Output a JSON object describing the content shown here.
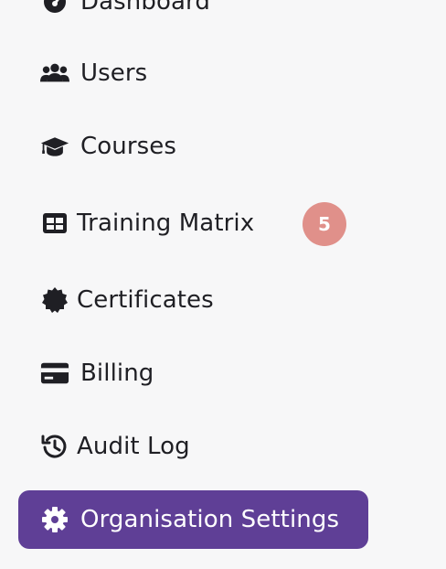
{
  "sidebar": {
    "items": [
      {
        "label": "Dashboard",
        "icon": "dashboard-icon"
      },
      {
        "label": "Users",
        "icon": "users-icon"
      },
      {
        "label": "Courses",
        "icon": "graduation-cap-icon"
      },
      {
        "label": "Training Matrix",
        "icon": "table-icon",
        "badge": "5"
      },
      {
        "label": "Certificates",
        "icon": "certificate-icon"
      },
      {
        "label": "Billing",
        "icon": "credit-card-icon"
      },
      {
        "label": "Audit Log",
        "icon": "history-icon"
      },
      {
        "label": "Organisation Settings",
        "icon": "gear-icon",
        "active": true
      }
    ],
    "active_color": "#5f3f96",
    "badge_color": "#e0908a"
  }
}
